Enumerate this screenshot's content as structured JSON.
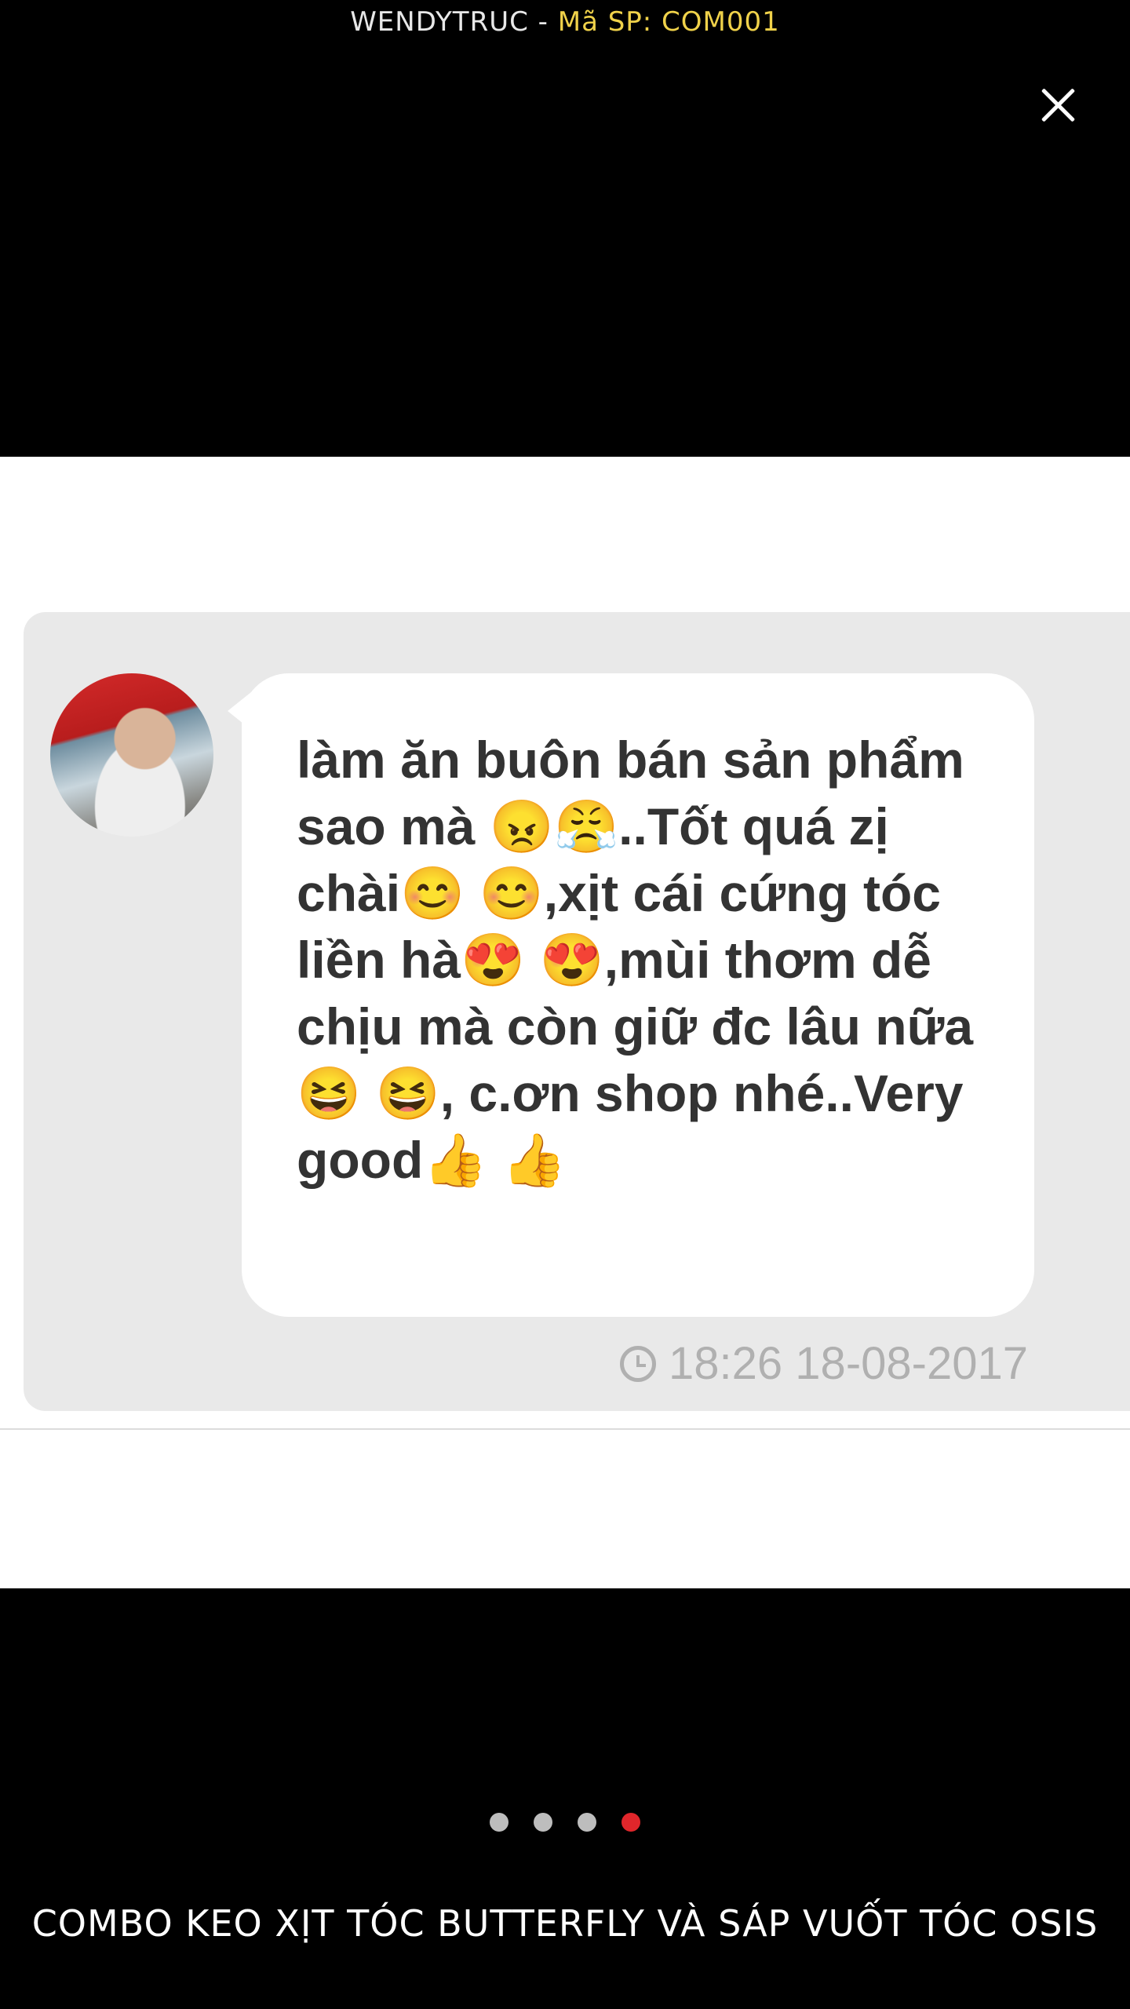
{
  "header": {
    "shop_name": "WENDYTRUC",
    "separator": " - ",
    "product_code": "Mã SP: COM001"
  },
  "close_icon": "close-icon",
  "review_image": {
    "message": "làm ăn buôn bán sản phẩm sao mà 😠😤..Tốt quá zị chài😊 😊,xịt cái cứng tóc liền hà😍 😍,mùi thơm dễ chịu mà còn giữ đc lâu nữa😆 😆, c.ơn shop nhé..Very good👍 👍",
    "timestamp": "18:26 18-08-2017"
  },
  "pagination": {
    "count": 4,
    "active_index": 3
  },
  "caption": "COMBO KEO XỊT TÓC BUTTERFLY VÀ SÁP VUỐT TÓC OSIS"
}
